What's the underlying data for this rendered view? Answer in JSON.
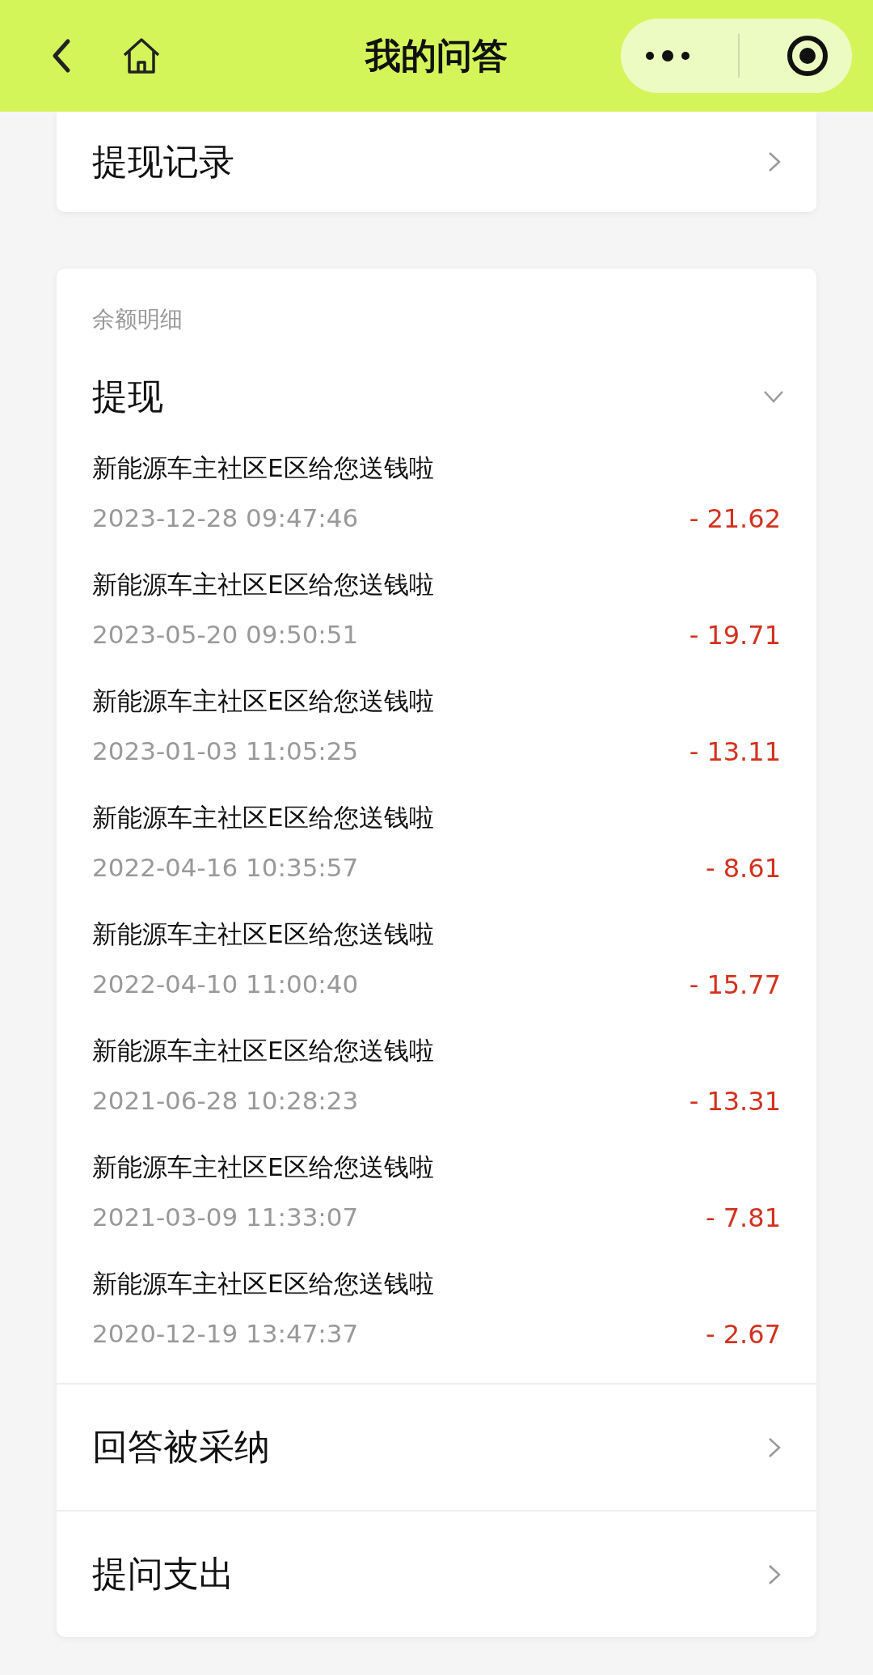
{
  "nav": {
    "title": "我的问答"
  },
  "top_item": {
    "label": "提现记录"
  },
  "balance": {
    "caption": "余额明细",
    "section": {
      "label": "提现",
      "expanded": true
    },
    "entries": [
      {
        "title": "新能源车主社区E区给您送钱啦",
        "time": "2023-12-28 09:47:46",
        "amount": "- 21.62"
      },
      {
        "title": "新能源车主社区E区给您送钱啦",
        "time": "2023-05-20 09:50:51",
        "amount": "- 19.71"
      },
      {
        "title": "新能源车主社区E区给您送钱啦",
        "time": "2023-01-03 11:05:25",
        "amount": "- 13.11"
      },
      {
        "title": "新能源车主社区E区给您送钱啦",
        "time": "2022-04-16 10:35:57",
        "amount": "- 8.61"
      },
      {
        "title": "新能源车主社区E区给您送钱啦",
        "time": "2022-04-10 11:00:40",
        "amount": "- 15.77"
      },
      {
        "title": "新能源车主社区E区给您送钱啦",
        "time": "2021-06-28 10:28:23",
        "amount": "- 13.31"
      },
      {
        "title": "新能源车主社区E区给您送钱啦",
        "time": "2021-03-09 11:33:07",
        "amount": "- 7.81"
      },
      {
        "title": "新能源车主社区E区给您送钱啦",
        "time": "2020-12-19 13:47:37",
        "amount": "- 2.67"
      }
    ],
    "other_sections": [
      {
        "label": "回答被采纳",
        "expanded": false
      },
      {
        "label": "提问支出",
        "expanded": false
      }
    ]
  }
}
